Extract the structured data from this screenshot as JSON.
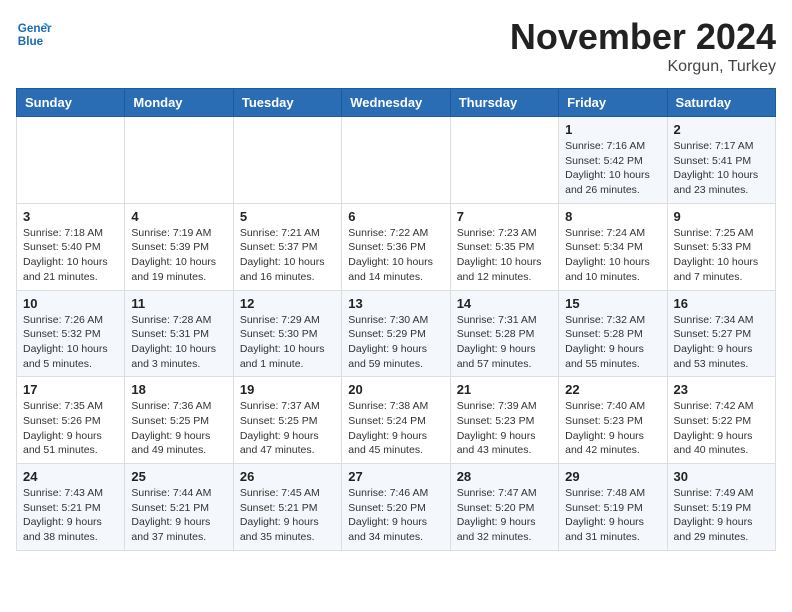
{
  "header": {
    "month_title": "November 2024",
    "location": "Korgun, Turkey",
    "logo_general": "General",
    "logo_blue": "Blue"
  },
  "weekdays": [
    "Sunday",
    "Monday",
    "Tuesday",
    "Wednesday",
    "Thursday",
    "Friday",
    "Saturday"
  ],
  "weeks": [
    [
      {
        "day": "",
        "info": ""
      },
      {
        "day": "",
        "info": ""
      },
      {
        "day": "",
        "info": ""
      },
      {
        "day": "",
        "info": ""
      },
      {
        "day": "",
        "info": ""
      },
      {
        "day": "1",
        "info": "Sunrise: 7:16 AM\nSunset: 5:42 PM\nDaylight: 10 hours and 26 minutes."
      },
      {
        "day": "2",
        "info": "Sunrise: 7:17 AM\nSunset: 5:41 PM\nDaylight: 10 hours and 23 minutes."
      }
    ],
    [
      {
        "day": "3",
        "info": "Sunrise: 7:18 AM\nSunset: 5:40 PM\nDaylight: 10 hours and 21 minutes."
      },
      {
        "day": "4",
        "info": "Sunrise: 7:19 AM\nSunset: 5:39 PM\nDaylight: 10 hours and 19 minutes."
      },
      {
        "day": "5",
        "info": "Sunrise: 7:21 AM\nSunset: 5:37 PM\nDaylight: 10 hours and 16 minutes."
      },
      {
        "day": "6",
        "info": "Sunrise: 7:22 AM\nSunset: 5:36 PM\nDaylight: 10 hours and 14 minutes."
      },
      {
        "day": "7",
        "info": "Sunrise: 7:23 AM\nSunset: 5:35 PM\nDaylight: 10 hours and 12 minutes."
      },
      {
        "day": "8",
        "info": "Sunrise: 7:24 AM\nSunset: 5:34 PM\nDaylight: 10 hours and 10 minutes."
      },
      {
        "day": "9",
        "info": "Sunrise: 7:25 AM\nSunset: 5:33 PM\nDaylight: 10 hours and 7 minutes."
      }
    ],
    [
      {
        "day": "10",
        "info": "Sunrise: 7:26 AM\nSunset: 5:32 PM\nDaylight: 10 hours and 5 minutes."
      },
      {
        "day": "11",
        "info": "Sunrise: 7:28 AM\nSunset: 5:31 PM\nDaylight: 10 hours and 3 minutes."
      },
      {
        "day": "12",
        "info": "Sunrise: 7:29 AM\nSunset: 5:30 PM\nDaylight: 10 hours and 1 minute."
      },
      {
        "day": "13",
        "info": "Sunrise: 7:30 AM\nSunset: 5:29 PM\nDaylight: 9 hours and 59 minutes."
      },
      {
        "day": "14",
        "info": "Sunrise: 7:31 AM\nSunset: 5:28 PM\nDaylight: 9 hours and 57 minutes."
      },
      {
        "day": "15",
        "info": "Sunrise: 7:32 AM\nSunset: 5:28 PM\nDaylight: 9 hours and 55 minutes."
      },
      {
        "day": "16",
        "info": "Sunrise: 7:34 AM\nSunset: 5:27 PM\nDaylight: 9 hours and 53 minutes."
      }
    ],
    [
      {
        "day": "17",
        "info": "Sunrise: 7:35 AM\nSunset: 5:26 PM\nDaylight: 9 hours and 51 minutes."
      },
      {
        "day": "18",
        "info": "Sunrise: 7:36 AM\nSunset: 5:25 PM\nDaylight: 9 hours and 49 minutes."
      },
      {
        "day": "19",
        "info": "Sunrise: 7:37 AM\nSunset: 5:25 PM\nDaylight: 9 hours and 47 minutes."
      },
      {
        "day": "20",
        "info": "Sunrise: 7:38 AM\nSunset: 5:24 PM\nDaylight: 9 hours and 45 minutes."
      },
      {
        "day": "21",
        "info": "Sunrise: 7:39 AM\nSunset: 5:23 PM\nDaylight: 9 hours and 43 minutes."
      },
      {
        "day": "22",
        "info": "Sunrise: 7:40 AM\nSunset: 5:23 PM\nDaylight: 9 hours and 42 minutes."
      },
      {
        "day": "23",
        "info": "Sunrise: 7:42 AM\nSunset: 5:22 PM\nDaylight: 9 hours and 40 minutes."
      }
    ],
    [
      {
        "day": "24",
        "info": "Sunrise: 7:43 AM\nSunset: 5:21 PM\nDaylight: 9 hours and 38 minutes."
      },
      {
        "day": "25",
        "info": "Sunrise: 7:44 AM\nSunset: 5:21 PM\nDaylight: 9 hours and 37 minutes."
      },
      {
        "day": "26",
        "info": "Sunrise: 7:45 AM\nSunset: 5:21 PM\nDaylight: 9 hours and 35 minutes."
      },
      {
        "day": "27",
        "info": "Sunrise: 7:46 AM\nSunset: 5:20 PM\nDaylight: 9 hours and 34 minutes."
      },
      {
        "day": "28",
        "info": "Sunrise: 7:47 AM\nSunset: 5:20 PM\nDaylight: 9 hours and 32 minutes."
      },
      {
        "day": "29",
        "info": "Sunrise: 7:48 AM\nSunset: 5:19 PM\nDaylight: 9 hours and 31 minutes."
      },
      {
        "day": "30",
        "info": "Sunrise: 7:49 AM\nSunset: 5:19 PM\nDaylight: 9 hours and 29 minutes."
      }
    ]
  ]
}
